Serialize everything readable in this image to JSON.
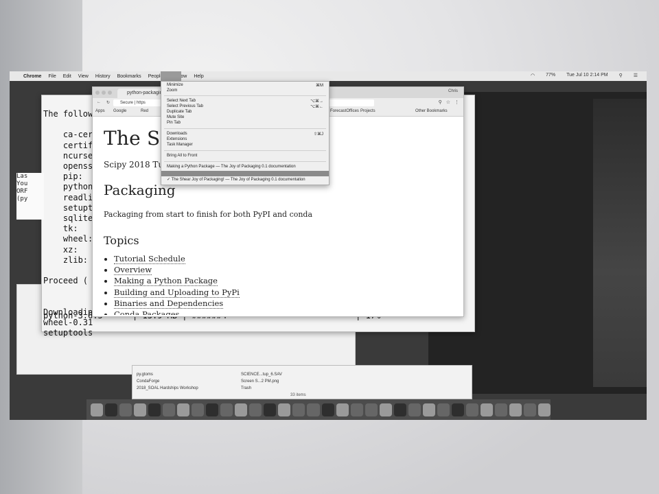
{
  "menubar": {
    "items": [
      "Chrome",
      "File",
      "Edit",
      "View",
      "History",
      "Bookmarks",
      "People",
      "Window",
      "Help"
    ],
    "status": "Tue Jul 10 2:14 PM",
    "battery": "77%"
  },
  "terminal": {
    "lines": [
      "The follow",
      "",
      "    ca-cer",
      "    certif",
      "    ncurse",
      "    openss",
      "    pip:",
      "    python",
      "    readli",
      "    setupt",
      "    sqlite",
      "    tk:",
      "    wheel:",
      "    xz:",
      "    zlib:",
      "",
      "Proceed (",
      "",
      "",
      "Downloadin",
      "wheel-0.31",
      "setuptools"
    ],
    "progress_line": "python-3.6.5      | 13.9 MB | ######4                          | 17%",
    "small_lines": [
      "Las",
      "You",
      "ORF",
      "(py"
    ]
  },
  "chrome": {
    "tab_title": "python-packagin",
    "profile": "Chris",
    "omnibox": "Secure | https",
    "bookmarks": [
      "Apps",
      "Google",
      "Red",
      "ForecastOffices",
      "Projects",
      "Other Bookmarks"
    ]
  },
  "page": {
    "title": "The Sh            g!",
    "subtitle": "Scipy 2018 Tuto",
    "section": "Packaging",
    "paragraph": "Packaging from start to finish for both PyPI and conda",
    "topics_heading": "Topics",
    "topics": [
      "Tutorial Schedule",
      "Overview",
      "Making a Python Package",
      "Building and Uploading to PyPi",
      "Binaries and Dependencies",
      "Conda Packages"
    ]
  },
  "window_menu": {
    "items": [
      {
        "label": "Minimize",
        "shortcut": "⌘M"
      },
      {
        "label": "Zoom",
        "shortcut": ""
      },
      {
        "label": "Select Next Tab",
        "shortcut": "⌥⌘→"
      },
      {
        "label": "Select Previous Tab",
        "shortcut": "⌥⌘←"
      },
      {
        "label": "Duplicate Tab",
        "shortcut": ""
      },
      {
        "label": "Mute Site",
        "shortcut": ""
      },
      {
        "label": "Pin Tab",
        "shortcut": ""
      },
      {
        "label": "Downloads",
        "shortcut": "⇧⌘J"
      },
      {
        "label": "Extensions",
        "shortcut": ""
      },
      {
        "label": "Task Manager",
        "shortcut": ""
      },
      {
        "label": "Bring All to Front",
        "shortcut": ""
      },
      {
        "label": "Making a Python Package — The Joy of Packaging 0.1 documentation",
        "shortcut": ""
      },
      {
        "label": "",
        "shortcut": ""
      },
      {
        "label": "✓ The Shear Joy of Packaging! — The Joy of Packaging 0.1 documentation",
        "shortcut": ""
      }
    ]
  },
  "finder": {
    "sidebar": [
      "py.gtoms",
      "CondaForge",
      "2018_SOAL Hardships Workshop"
    ],
    "files": [
      "SCIENCE...tup_6.SAV",
      "Screen S...2 PM.png",
      "Trash"
    ],
    "status": "33 items"
  }
}
